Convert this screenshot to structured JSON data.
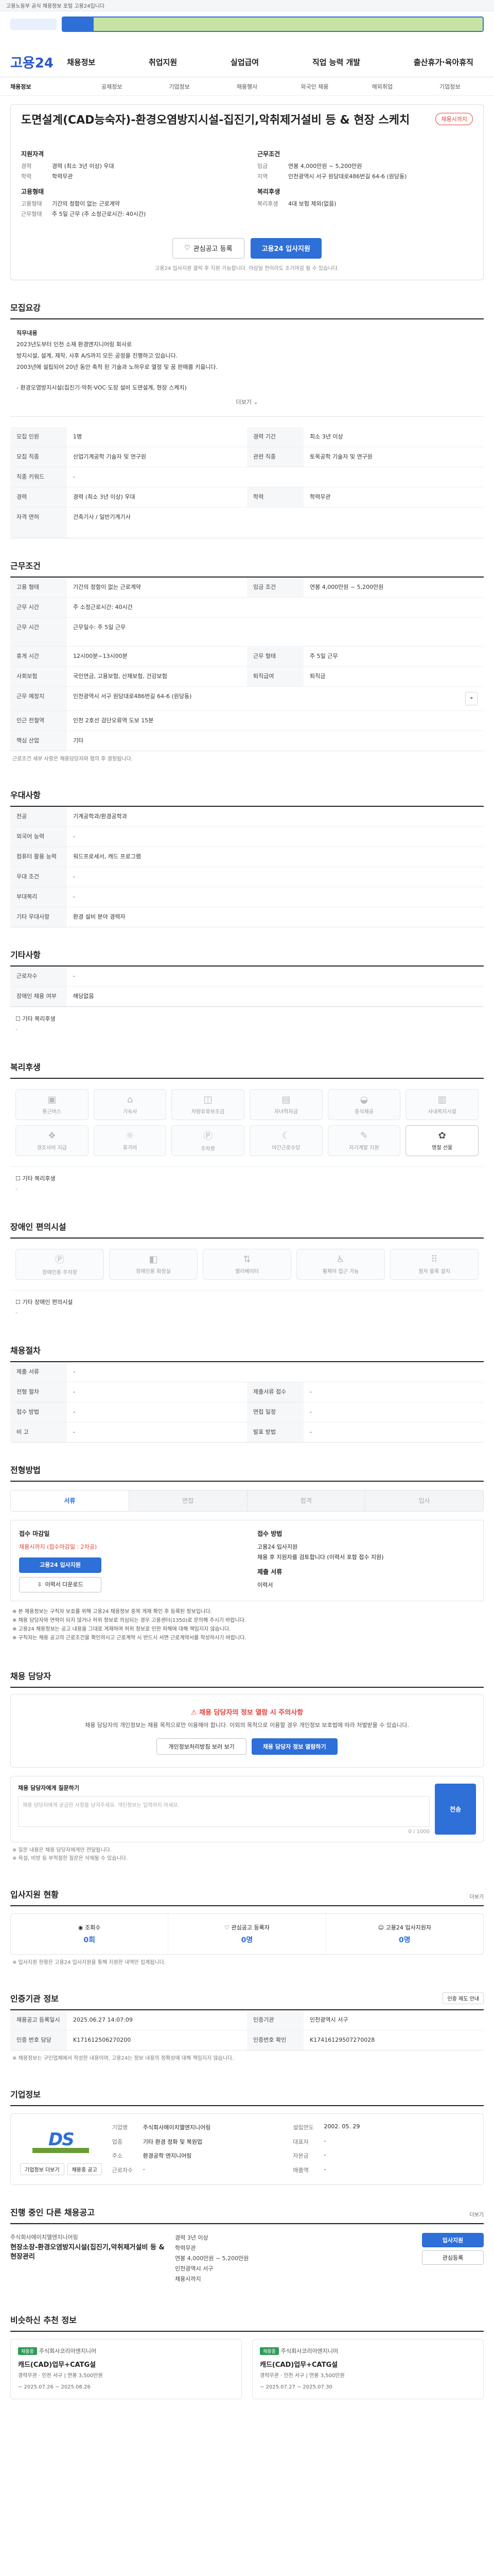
{
  "topbar": {
    "text": "고용노동부 공식 채용정보 포털 고용24입니다"
  },
  "nav": {
    "brand": "고용24",
    "menu": [
      "채용정보",
      "취업지원",
      "실업급여",
      "직업 능력 개발",
      "출산휴가·육아휴직"
    ],
    "subnav": [
      "채용정보",
      "공채정보",
      "기업정보",
      "채용행사",
      "외국인 채용",
      "해외취업",
      "기업정보"
    ]
  },
  "job": {
    "title": "도면설계(CAD능숙자)-환경오염방지시설-집진기,악취제거설비 등 & 현장 스케치",
    "status_badge": "채용시까지",
    "summary_left_h1": "지원자격",
    "summary_left": [
      {
        "k": "경력",
        "v": "경력 (최소 3년 이상) 우대"
      },
      {
        "k": "학력",
        "v": "학력무관"
      }
    ],
    "summary_left_h2": "고용형태",
    "summary_left2": [
      {
        "k": "고용형태",
        "v": "기간의 정함이 없는 근로계약"
      },
      {
        "k": "근무형태",
        "v": "주 5일 근무 (주 소정근로시간: 40시간)"
      }
    ],
    "summary_right_h1": "근무조건",
    "summary_right": [
      {
        "k": "임금",
        "v": "연봉 4,000만원 ~ 5,200만원"
      },
      {
        "k": "지역",
        "v": "인천광역시 서구 원당대로486번길 64-6 (원당동)"
      }
    ],
    "summary_right_h2": "복리후생",
    "summary_right2": [
      {
        "k": "복리후생",
        "v": "4대 보험 제외(없음)"
      }
    ],
    "btn_scrap": "관심공고 등록",
    "btn_apply": "고용24 입사지원",
    "apply_note": "고용24 입사지원 클릭 후 지원 가능합니다. 마감일 전이라도 조기마감 될 수 있습니다."
  },
  "desc": {
    "section": "모집요강",
    "lines": [
      "직무내용",
      "2023년도부터 인천 소재 환경엔지니어링 회사로",
      "방지시설, 설계, 제작, 사후 A/S까지 모든 공정을 진행하고 있습니다.",
      "2003년에 설립되어 20년 동안 축적 된 기술과 노하우로 열정 및 꿈 판매를 키웁니다.",
      "- 환경오염방지시설(집진기·악취·VOC·도장 설비 도면설계, 현장 스케치)"
    ],
    "more": "더보기"
  },
  "recruit_table": [
    {
      "k": "모집 인원",
      "v": "1명",
      "k2": "경력 기간",
      "v2": "최소 3년 이상"
    },
    {
      "k": "모집 직종",
      "v": "산업기계공학 기술자 및 연구원",
      "k2": "관련 직종",
      "v2": "토목공학 기술자 및 연구원"
    },
    {
      "k": "직종 키워드",
      "v": "-",
      "k2": "",
      "v2": ""
    },
    {
      "k": "경력",
      "v": "경력 (최소 3년 이상) 우대",
      "k2": "학력",
      "v2": "학력무관"
    },
    {
      "k": "자격 면허",
      "v": "건축기사 / 일반기계기사",
      "k2": "",
      "v2": ""
    }
  ],
  "work": {
    "section": "근무조건",
    "rows": [
      {
        "k": "고용 형태",
        "v": "기간의 정함이 없는 근로계약",
        "k2": "임금 조건",
        "v2": "연봉 4,000만원 ~ 5,200만원"
      },
      {
        "k": "근무 시간",
        "v": "주 소정근로시간: 40시간",
        "k2": "",
        "v2": ""
      },
      {
        "k": "근무 시간",
        "v": "근무일수: 주 5일 근무",
        "k2": "",
        "v2": ""
      },
      {
        "k": "휴게 시간",
        "v": "12시00분~13시00분",
        "k2": "근무 형태",
        "v2": "주 5일 근무"
      },
      {
        "k": "사회보험",
        "v": "국민연금, 고용보험, 산재보험, 건강보험",
        "k2": "퇴직급여",
        "v2": "퇴직금"
      },
      {
        "k": "근무 예정지",
        "v": "인천광역시 서구 원당대로486번길 64-6 (원당동)",
        "k2": "",
        "v2": ""
      },
      {
        "k": "인근 전철역",
        "v": "인천 2호선 검단오류역 도보 15분",
        "k2": "",
        "v2": ""
      },
      {
        "k": "핵심 산업",
        "v": "기타",
        "k2": "",
        "v2": ""
      }
    ],
    "note": "근로조건 세부 사항은 채용담당자와 협의 후 결정됩니다."
  },
  "prefer": {
    "section": "우대사항",
    "rows": [
      {
        "k": "전공",
        "v": "기계공학과/환경공학과"
      },
      {
        "k": "외국어 능력",
        "v": "-"
      },
      {
        "k": "컴퓨터 활용 능력",
        "v": "워드프로세서, 캐드 프로그램"
      },
      {
        "k": "우대 조건",
        "v": "-"
      },
      {
        "k": "부대복리",
        "v": "-"
      },
      {
        "k": "기타 우대사항",
        "v": "환경 설비 분야 경력자"
      }
    ]
  },
  "etc": {
    "section": "기타사항",
    "rows": [
      {
        "k": "근로자수",
        "v": "-"
      },
      {
        "k": "장애인 채용 여부",
        "v": "해당없음"
      }
    ],
    "sub_h": "기타 복리후생",
    "sub_v": "-"
  },
  "welfare": {
    "section": "복리후생",
    "items": [
      "통근버스",
      "기숙사",
      "차량유류보조금",
      "자녀학자금",
      "중식제공",
      "사내복지시설",
      "경조사비 지급",
      "휴가비",
      "주차장",
      "야간근로수당",
      "자기계발 지원",
      "명절 선물"
    ],
    "active_index": 11,
    "sub_h": "기타 복리후생",
    "sub_v": "-"
  },
  "disability": {
    "section": "장애인 편의시설",
    "items": [
      "장애인용 주차장",
      "장애인용 화장실",
      "엘리베이터",
      "휠체어 접근 가능",
      "점자 블록 설치"
    ],
    "sub_h": "기타 장애인 편의시설",
    "sub_v": "-"
  },
  "selection": {
    "section": "채용절차",
    "rows": [
      {
        "k": "제출 서류",
        "v": "-",
        "k2": "",
        "v2": ""
      },
      {
        "k": "전형 절차",
        "v": "-",
        "k2": "제출서류 접수",
        "v2": "-"
      },
      {
        "k": "접수 방법",
        "v": "-",
        "k2": "면접 일정",
        "v2": "-"
      },
      {
        "k": "비 고",
        "v": "-",
        "k2": "발표 방법",
        "v2": "-"
      }
    ]
  },
  "apply": {
    "section": "전형방법",
    "steps": [
      "서류",
      "면접",
      "합격",
      "입사"
    ],
    "left_h": "접수 마감일",
    "left_v": "채용시까지 (접수마감일 : 2차공)",
    "left_btn": "고용24 입사지원",
    "left_btn2": "이력서 다운로드",
    "right_h": "접수 방법",
    "right_lines": [
      "고용24 입사지원",
      "채용 후 지원자를 검토합니다 (이력서 포함 접수 지원)",
      "제출 서류",
      "이력서"
    ],
    "notices": [
      "※ 본 채용정보는 구직자 보호를 위해 고용24 채용정보 중복 게재 확인 후 등록된 정보입니다.",
      "※ 채용 담당자와 연락이 되지 않거나 허위 정보로 의심되는 경우 고용센터(1350)로 문의해 주시기 바랍니다.",
      "※ 고용24 채용정보는 공고 내용을 그대로 게재하며 허위 정보로 인한 피해에 대해 책임지지 않습니다.",
      "※ 구직자는 채용 공고의 근로조건을 확인하시고 근로계약 시 반드시 서면 근로계약서를 작성하시기 바랍니다."
    ]
  },
  "contact": {
    "section": "채용 담당자",
    "alert_h": "채용 담당자의 정보 열람 시 주의사항",
    "alert_p": "채용 담당자의 개인정보는 채용 목적으로만 이용해야 합니다. 이외의 목적으로 이용할 경우 개인정보 보호법에 따라 처벌받을 수 있습니다.",
    "btn_view": "개인정보처리방침 보러 보기",
    "btn_show": "채용 담당자 정보 열람하기",
    "q_label": "채용 담당자에게 질문하기",
    "q_placeholder": "채용 담당자에게 궁금한 사항을 남겨주세요. 개인정보는 입력하지 마세요.",
    "q_btn": "전송",
    "q_count": "0 / 1000",
    "q_notes": [
      "※ 질문 내용은 채용 담당자에게만 전달됩니다.",
      "※ 욕설, 비방 등 부적절한 질문은 삭제될 수 있습니다."
    ]
  },
  "stats": {
    "section": "입사지원 현황",
    "more": "더보기",
    "items": [
      {
        "label": "조회수",
        "n": "0회"
      },
      {
        "label": "관심공고 등록자",
        "n": "0명"
      },
      {
        "label": "고용24 입사지원자",
        "n": "0명"
      }
    ],
    "note": "※ 입사지원 현황은 고용24 입사지원을 통해 지원한 내역만 집계됩니다."
  },
  "meta": {
    "section": "인증기관 정보",
    "btn": "인증 제도 안내",
    "rows": [
      {
        "k": "채용공고 등록일시",
        "v": "2025.06.27 14:07:09",
        "k2": "인증기관",
        "v2": "인천광역시 서구"
      },
      {
        "k": "인증 번호 담당",
        "v": "K171612506270200",
        "k2": "인증번호 확인",
        "v2": "K17416129507270028"
      }
    ],
    "note": "※ 채용정보는 구인업체에서 작성한 내용이며, 고용24는 정보 내용의 정확성에 대해 책임지지 않습니다."
  },
  "company": {
    "section": "기업정보",
    "logo_text": "DS",
    "btn_more": "기업정보 더보기",
    "btn_list": "채용중 공고",
    "rows": [
      {
        "k": "기업명",
        "v": "주식회사에이치엘엔지니어링",
        "k2": "설립연도",
        "v2": "2002. 05. 29"
      },
      {
        "k": "업종",
        "v": "기타 환경 정화 및 복원업",
        "k2": "대표자",
        "v2": "-"
      },
      {
        "k": "주소",
        "v": "환경공학 엔지니어링",
        "k2": "자본금",
        "v2": "-"
      },
      {
        "k": "근로자수",
        "v": "-",
        "k2": "매출액",
        "v2": "-"
      }
    ]
  },
  "related": {
    "section": "진행 중인 다른 채용공고",
    "more": "더보기",
    "items": [
      {
        "company": "주식회사에이치엘엔지니어링",
        "title": "현장소장-환경오염방지시설(집진기,악취제거설비 등 & 현장관리",
        "meta": [
          "경력 3년 이상",
          "학력무관",
          "연봉 4,000만원 ~ 5,200만원",
          "인천광역시 서구",
          "채용시까지"
        ],
        "btn1": "입사지원",
        "btn2": "관심등록"
      }
    ]
  },
  "recommend": {
    "section": "비슷하신 추천 정보",
    "items": [
      {
        "badge": "채용중",
        "company": "주식회사코리아엔지니어",
        "title": "캐드(CAD)업무+CATG설",
        "meta": "경력무관 · 인천 서구 | 연봉 3,500만원",
        "date": "~ 2025.07.26 ~ 2025.08.26"
      },
      {
        "badge": "채용중",
        "company": "주식회사코리아엔지니어",
        "title": "캐드(CAD)업무+CATG설",
        "meta": "경력무관 · 인천 서구 | 연봉 3,500만원",
        "date": "~ 2025.07.27 ~ 2025.07.30"
      }
    ]
  }
}
